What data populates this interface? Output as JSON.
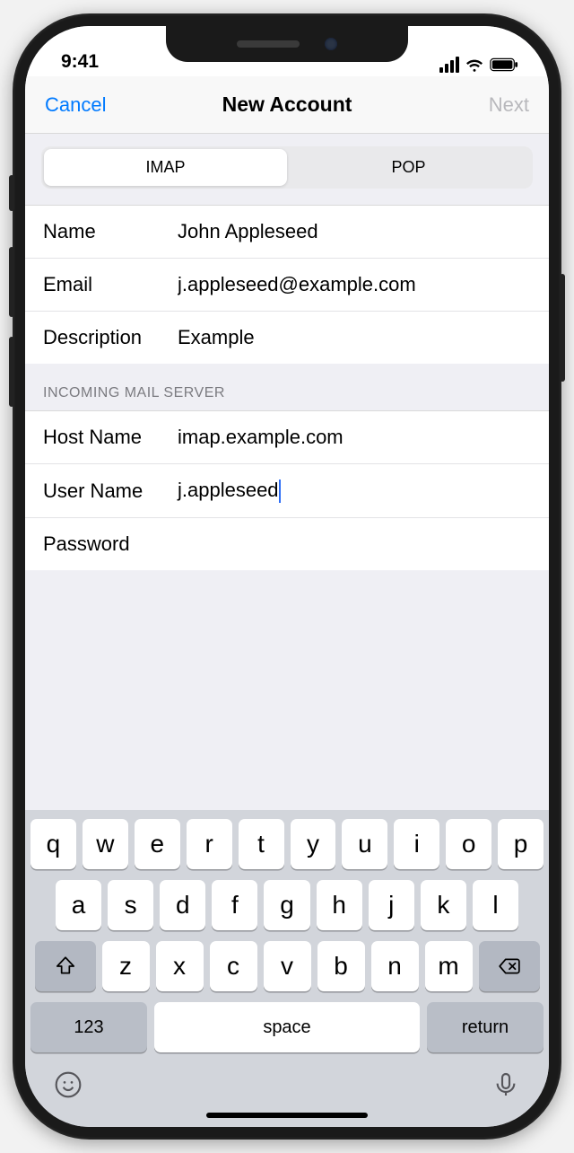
{
  "status": {
    "time": "9:41"
  },
  "nav": {
    "cancel": "Cancel",
    "title": "New Account",
    "next": "Next"
  },
  "seg": {
    "imap": "IMAP",
    "pop": "POP",
    "selected": "imap"
  },
  "account": {
    "name_label": "Name",
    "name_value": "John Appleseed",
    "email_label": "Email",
    "email_value": "j.appleseed@example.com",
    "desc_label": "Description",
    "desc_value": "Example"
  },
  "incoming": {
    "header": "INCOMING MAIL SERVER",
    "host_label": "Host Name",
    "host_value": "imap.example.com",
    "user_label": "User Name",
    "user_value": "j.appleseed",
    "pass_label": "Password",
    "pass_value": ""
  },
  "keyboard": {
    "row1": [
      "q",
      "w",
      "e",
      "r",
      "t",
      "y",
      "u",
      "i",
      "o",
      "p"
    ],
    "row2": [
      "a",
      "s",
      "d",
      "f",
      "g",
      "h",
      "j",
      "k",
      "l"
    ],
    "row3": [
      "z",
      "x",
      "c",
      "v",
      "b",
      "n",
      "m"
    ],
    "numKey": "123",
    "space": "space",
    "return": "return"
  }
}
